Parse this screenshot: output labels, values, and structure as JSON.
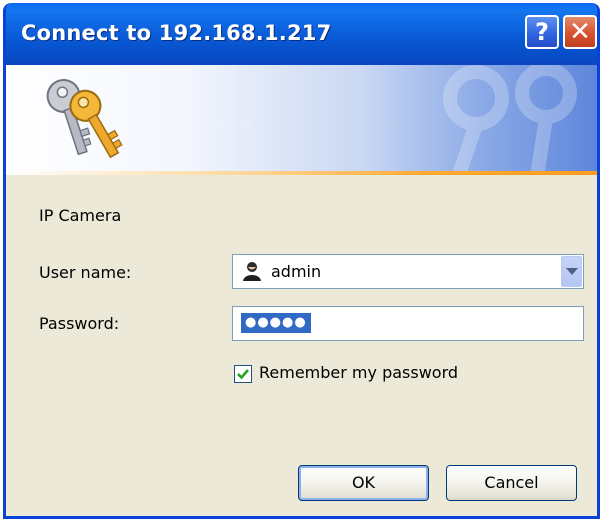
{
  "window": {
    "title": "Connect to 192.168.1.217",
    "help_glyph": "?",
    "close_glyph": "✕"
  },
  "banner": {
    "icon": "keys-icon"
  },
  "form": {
    "realm": "IP Camera",
    "user_label": "User name:",
    "user_value": "admin",
    "user_icon": "user-icon",
    "password_label": "Password:",
    "password_mask": "●●●●●",
    "remember_label": "Remember my password",
    "remember_checked": true
  },
  "buttons": {
    "ok": "OK",
    "cancel": "Cancel"
  },
  "colors": {
    "titlebar": "#0a5ad7",
    "dialog_bg": "#ece9d8",
    "selection": "#316ac5",
    "accent_line": "#ff9a1c"
  }
}
